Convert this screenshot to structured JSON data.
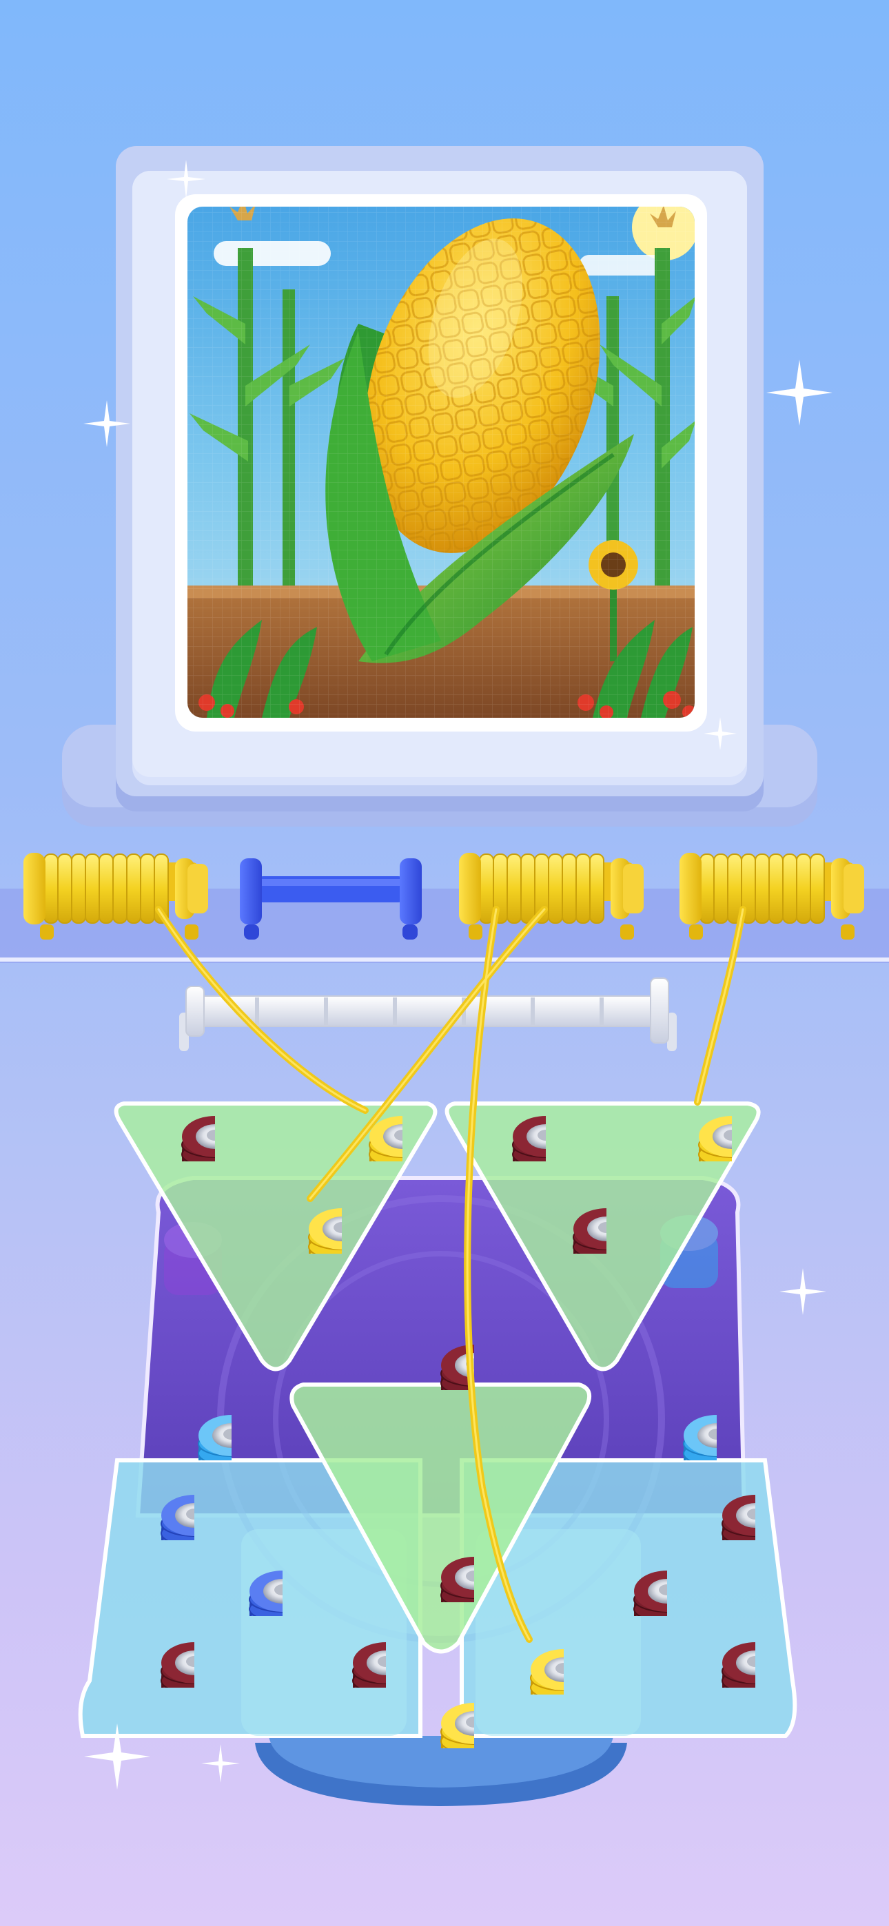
{
  "scene": {
    "picture_subject": "pixel-art corn",
    "colors": {
      "background_top": "#80b8fb",
      "background_bottom": "#dccbf9",
      "frame": "#c3d0f5",
      "yarn_yellow": "#f4d222",
      "yarn_maroon": "#7a1e2b",
      "yarn_blue": "#3a62e0",
      "yarn_cyan": "#35a8ef",
      "yarn_purple": "#7c3fd6",
      "spool_blue": "#3b5cf0",
      "spool_white": "#f2f4f8",
      "tray_green": "#a8ef9e",
      "tray_cyan": "#8fdcef",
      "tray_purple": "#6c4fc8"
    }
  },
  "spools": [
    {
      "name": "spool-1",
      "color": "yellow",
      "filled": true
    },
    {
      "name": "spool-2",
      "color": "blue",
      "filled": false
    },
    {
      "name": "spool-3",
      "color": "yellow",
      "filled": true
    },
    {
      "name": "spool-4",
      "color": "yellow",
      "filled": true
    }
  ],
  "reserve_spool": {
    "color": "white",
    "filled": false
  },
  "peg_counts": {
    "yellow": 6,
    "maroon": 12,
    "blue": 3,
    "cyan": 3
  }
}
